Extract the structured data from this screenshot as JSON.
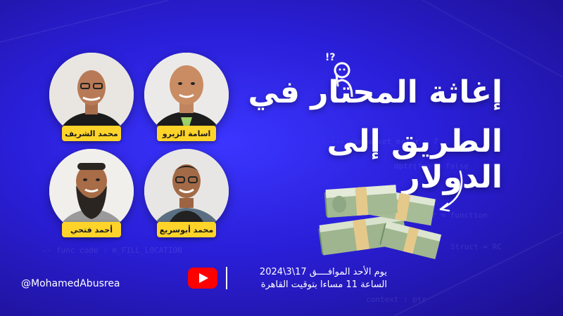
{
  "title": {
    "line1": "إغاثة المحتار في",
    "line2": "الطريق إلى الدولار"
  },
  "speakers": [
    {
      "name": "محمد الشريف"
    },
    {
      "name": "اسامة الزيرو"
    },
    {
      "name": "أحمد فتحي"
    },
    {
      "name": "محمد أبوسريع"
    }
  ],
  "schedule": {
    "line1": "يوم الأحد الموافــــق 17\\3\\2024",
    "line2": "الساعة 11 مساءا بتوقيت القاهرة"
  },
  "handle": "@MohamedAbusrea",
  "icons": [
    "youtube-icon",
    "thinking-person-icon",
    "money-stack-icon",
    "arrow-icon"
  ],
  "colors": {
    "background": "#2a1fd8",
    "name_tag": "#ffd42a",
    "youtube": "#ff0000"
  }
}
